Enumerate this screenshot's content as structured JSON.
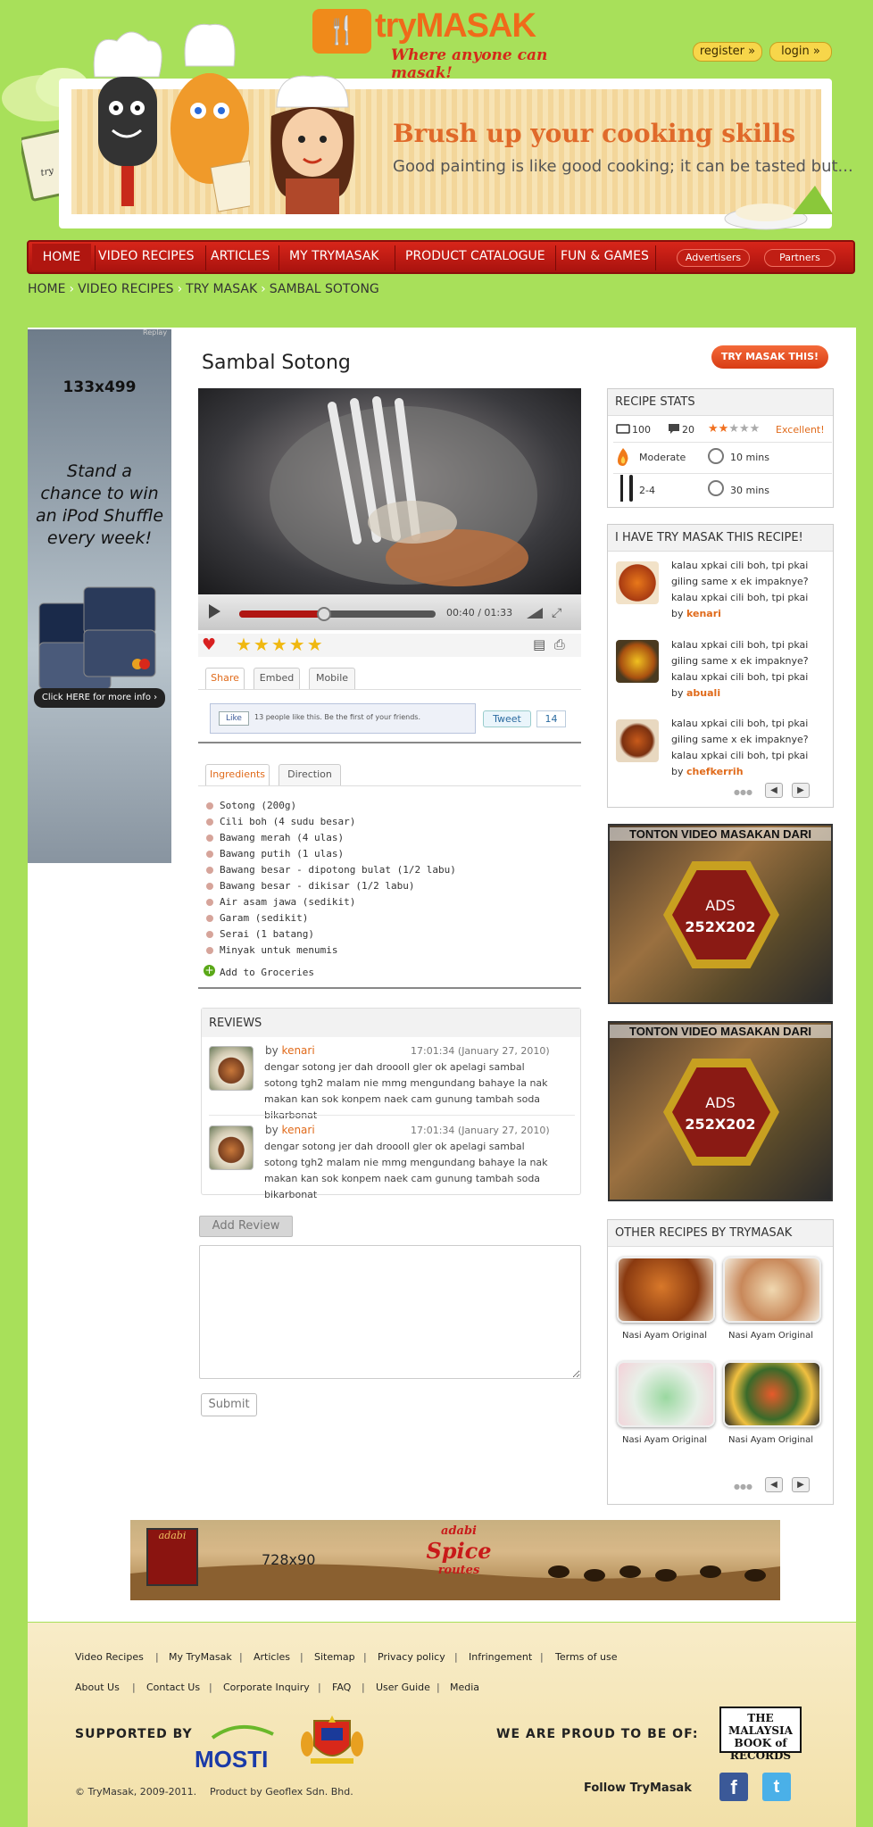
{
  "brand": {
    "mark": "🍴",
    "name": "tryMASAK",
    "tagline": "Where anyone can masak!"
  },
  "account": {
    "register": "register »",
    "login": "login »"
  },
  "banner": {
    "title": "Brush up your cooking skills",
    "subtitle": "Good painting is like good cooking; it can be tasted but..."
  },
  "nav": {
    "items": [
      "HOME",
      "VIDEO RECIPES",
      "ARTICLES",
      "MY TRYMASAK",
      "PRODUCT CATALOGUE",
      "FUN & GAMES"
    ],
    "pills": [
      "Advertisers",
      "Partners"
    ]
  },
  "breadcrumb": [
    "HOME",
    "VIDEO RECIPES",
    "TRY MASAK",
    "SAMBAL SOTONG"
  ],
  "left_ad": {
    "size": "133x499",
    "copy": "Stand a chance to win an iPod Shuffle every week!",
    "button": "Click HERE for more info ›",
    "replay": "Replay"
  },
  "recipe": {
    "title": "Sambal Sotong",
    "try_button": "TRY MASAK THIS!",
    "player": {
      "time": "00:40 / 01:33",
      "progress": 0.43
    },
    "rating_stars": "★★★★★",
    "share_tabs": [
      "Share",
      "Embed",
      "Mobile"
    ],
    "like_button": "Like",
    "like_text": "13 people like this. Be the first of your friends.",
    "tweet": "Tweet",
    "tweet_count": "14",
    "ingredient_tabs": [
      "Ingredients",
      "Direction"
    ],
    "ingredients": [
      "Sotong (200g)",
      "Cili boh (4 sudu besar)",
      "Bawang merah (4 ulas)",
      "Bawang putih (1 ulas)",
      "Bawang besar - dipotong bulat (1/2 labu)",
      "Bawang besar - dikisar (1/2 labu)",
      "Air asam jawa (sedikit)",
      "Garam (sedikit)",
      "Serai (1 batang)",
      "Minyak untuk menumis"
    ],
    "add_groceries": "Add to Groceries"
  },
  "reviews": {
    "title": "REVIEWS",
    "items": [
      {
        "by": "by ",
        "user": "kenari",
        "time": "17:01:34 (January 27, 2010)",
        "text": "dengar sotong jer dah droooll gler ok apelagi sambal sotong tgh2 malam nie mmg mengundang bahaye la nak makan kan sok konpem naek cam gunung tambah soda bikarbonat"
      },
      {
        "by": "by ",
        "user": "kenari",
        "time": "17:01:34 (January 27, 2010)",
        "text": "dengar sotong jer dah droooll gler ok apelagi sambal sotong tgh2 malam nie mmg mengundang bahaye la nak makan kan sok konpem naek cam gunung tambah soda bikarbonat"
      }
    ],
    "add_review": "Add Review",
    "submit": "Submit"
  },
  "stats": {
    "title": "RECIPE STATS",
    "views": "100",
    "comments": "20",
    "rating": 2,
    "rating_label": "Excellent!",
    "difficulty": "Moderate",
    "prep_time": "10 mins",
    "servings": "2-4",
    "cook_time": "30 mins"
  },
  "tried": {
    "title": "I HAVE TRY MASAK THIS RECIPE!",
    "items": [
      {
        "text": "kalau xpkai cili boh, tpi pkai giling same x ek impaknye? kalau xpkai cili boh, tpi pkai",
        "by": "by ",
        "user": "kenari"
      },
      {
        "text": "kalau xpkai cili boh, tpi pkai giling same x ek impaknye? kalau xpkai cili boh, tpi pkai",
        "by": "by ",
        "user": "abuali"
      },
      {
        "text": "kalau xpkai cili boh, tpi pkai giling same x ek impaknye? kalau xpkai cili boh, tpi pkai",
        "by": "by ",
        "user": "chefkerrih"
      }
    ],
    "dots": "●●●"
  },
  "ads": [
    {
      "top": "TONTON VIDEO MASAKAN DARI",
      "l1": "ADS",
      "l2": "252X202"
    },
    {
      "top": "TONTON VIDEO MASAKAN DARI",
      "l1": "ADS",
      "l2": "252X202"
    }
  ],
  "other": {
    "title": "OTHER RECIPES BY TRYMASAK",
    "items": [
      "Nasi Ayam Original",
      "Nasi Ayam Original",
      "Nasi Ayam Original",
      "Nasi Ayam Original"
    ]
  },
  "bottom_ad": {
    "brand": "adabi",
    "size": "728x90",
    "line1": "adabi",
    "line2": "Spice",
    "line3": "routes"
  },
  "footer": {
    "links1": [
      "Video Recipes",
      "My TryMasak",
      "Articles",
      "Sitemap",
      "Privacy policy",
      "Infringement",
      "Terms of use"
    ],
    "links2": [
      "About Us",
      "Contact Us",
      "Corporate Inquiry",
      "FAQ",
      "User Guide",
      "Media"
    ],
    "supported": "SUPPORTED BY",
    "mosti": "MOSTI",
    "proud": "WE ARE PROUD TO BE OF:",
    "mbr": "THE MALAYSIA BOOK of RECORDS",
    "copyright": "© TryMasak, 2009-2011.",
    "product": "Product by Geoflex Sdn. Bhd.",
    "follow": "Follow TryMasak",
    "fb": "f",
    "tw": "t"
  }
}
